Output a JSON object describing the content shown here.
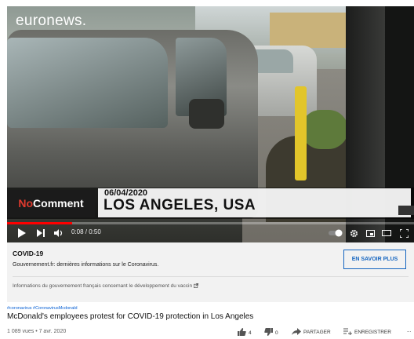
{
  "video": {
    "channel_logo": "euronews.",
    "brand": {
      "prefix": "No",
      "suffix": "Comment"
    },
    "overlay": {
      "date": "06/04/2020",
      "location": "LOS ANGELES, USA"
    },
    "player": {
      "time": "0:08 / 0:50",
      "progress_fraction": 0.16,
      "icons": [
        "play-icon",
        "next-icon",
        "volume-icon",
        "autoplay-toggle-icon",
        "settings-icon",
        "miniplayer-icon",
        "theater-icon",
        "fullscreen-icon"
      ]
    }
  },
  "info_card": {
    "title": "COVID-19",
    "subtitle": "Gouvernement.fr: dernières informations sur le Coronavirus.",
    "button_label": "EN SAVOIR PLUS",
    "link_text": "Informations du gouvernement français concernant le développement du vaccin",
    "accent": "#1565c0"
  },
  "metadata": {
    "hashtags": "#coronavirus #CoronavirusMcdonald",
    "title": "McDonald's employees protest for COVID-19 protection in Los Angeles",
    "stats": "1 089 vues • 7 avr. 2020",
    "likes": "4",
    "dislikes": "0",
    "share_label": "PARTAGER",
    "save_label": "ENREGISTRER",
    "more_label": "..."
  },
  "colors": {
    "progress_red": "#ff0000",
    "nocomment_red": "#e03a2e",
    "link_blue": "#065fd4"
  }
}
